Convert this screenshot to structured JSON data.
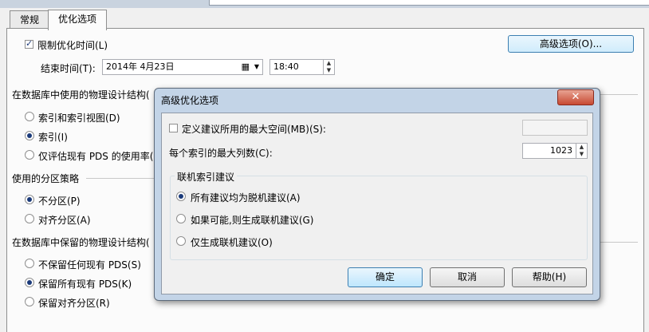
{
  "tabs": [
    {
      "label": "常规"
    },
    {
      "label": "优化选项"
    }
  ],
  "options": {
    "limit_time_label": "限制优化时间(L)",
    "end_time_label": "结束时间(T):",
    "end_date_value": "2014年 4月23日",
    "end_time_value": "18:40",
    "advanced_button": "高级选项(O)...",
    "pds_section_label": "在数据库中使用的物理设计结构(",
    "pds_options": [
      "索引和索引视图(D)",
      "索引(I)",
      "仅评估现有 PDS 的使用率("
    ],
    "partition_section_label": "使用的分区策略",
    "partition_options": [
      "不分区(P)",
      "对齐分区(A)"
    ],
    "keep_section_label": "在数据库中保留的物理设计结构(",
    "keep_options": [
      "不保留任何现有 PDS(S)",
      "保留所有现有 PDS(K)",
      "保留对齐分区(R)"
    ]
  },
  "dialog": {
    "title": "高级优化选项",
    "close_glyph": "✕",
    "max_space_label": "定义建议所用的最大空间(MB)(S):",
    "max_space_value": "",
    "max_columns_label": "每个索引的最大列数(C):",
    "max_columns_value": "1023",
    "online_group_label": "联机索引建议",
    "online_options": [
      "所有建议均为脱机建议(A)",
      "如果可能,则生成联机建议(G)",
      "仅生成联机建议(O)"
    ],
    "ok_button": "确定",
    "cancel_button": "取消",
    "help_button": "帮助(H)"
  }
}
